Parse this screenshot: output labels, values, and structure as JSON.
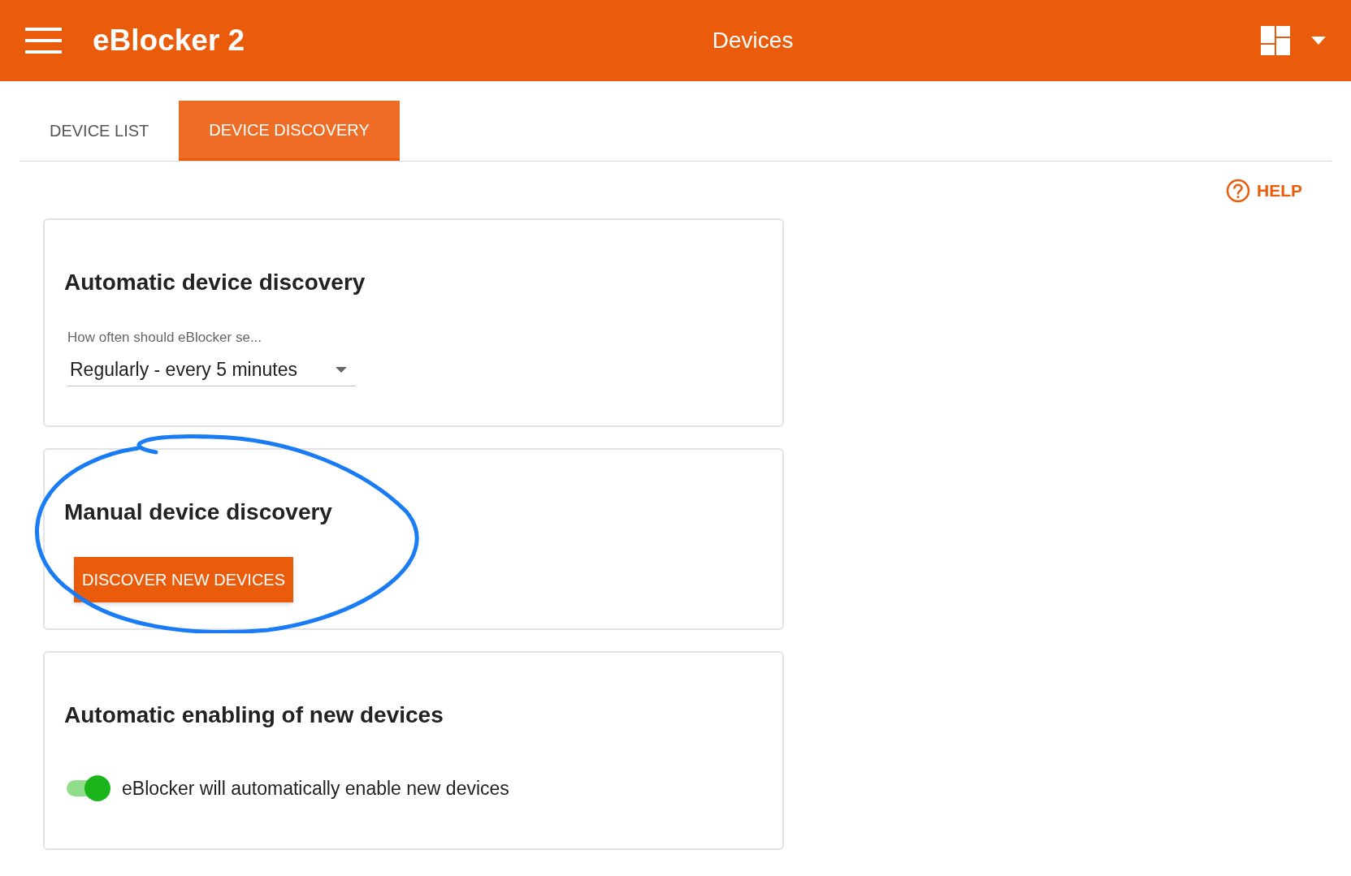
{
  "header": {
    "app_title": "eBlocker 2",
    "page_title": "Devices"
  },
  "tabs": [
    {
      "label": "DEVICE LIST",
      "selected": false
    },
    {
      "label": "DEVICE DISCOVERY",
      "selected": true
    }
  ],
  "help": {
    "label": "HELP"
  },
  "cards": [
    {
      "kind": "select",
      "title": "Automatic device discovery",
      "field_label": "How often should eBlocker se...",
      "value": "Regularly - every 5 minutes"
    },
    {
      "kind": "button",
      "title": "Manual device discovery",
      "button": "DISCOVER NEW DEVICES"
    },
    {
      "kind": "toggle",
      "title": "Automatic enabling of new devices",
      "on": true,
      "label": "eBlocker will automatically enable new devices"
    }
  ]
}
